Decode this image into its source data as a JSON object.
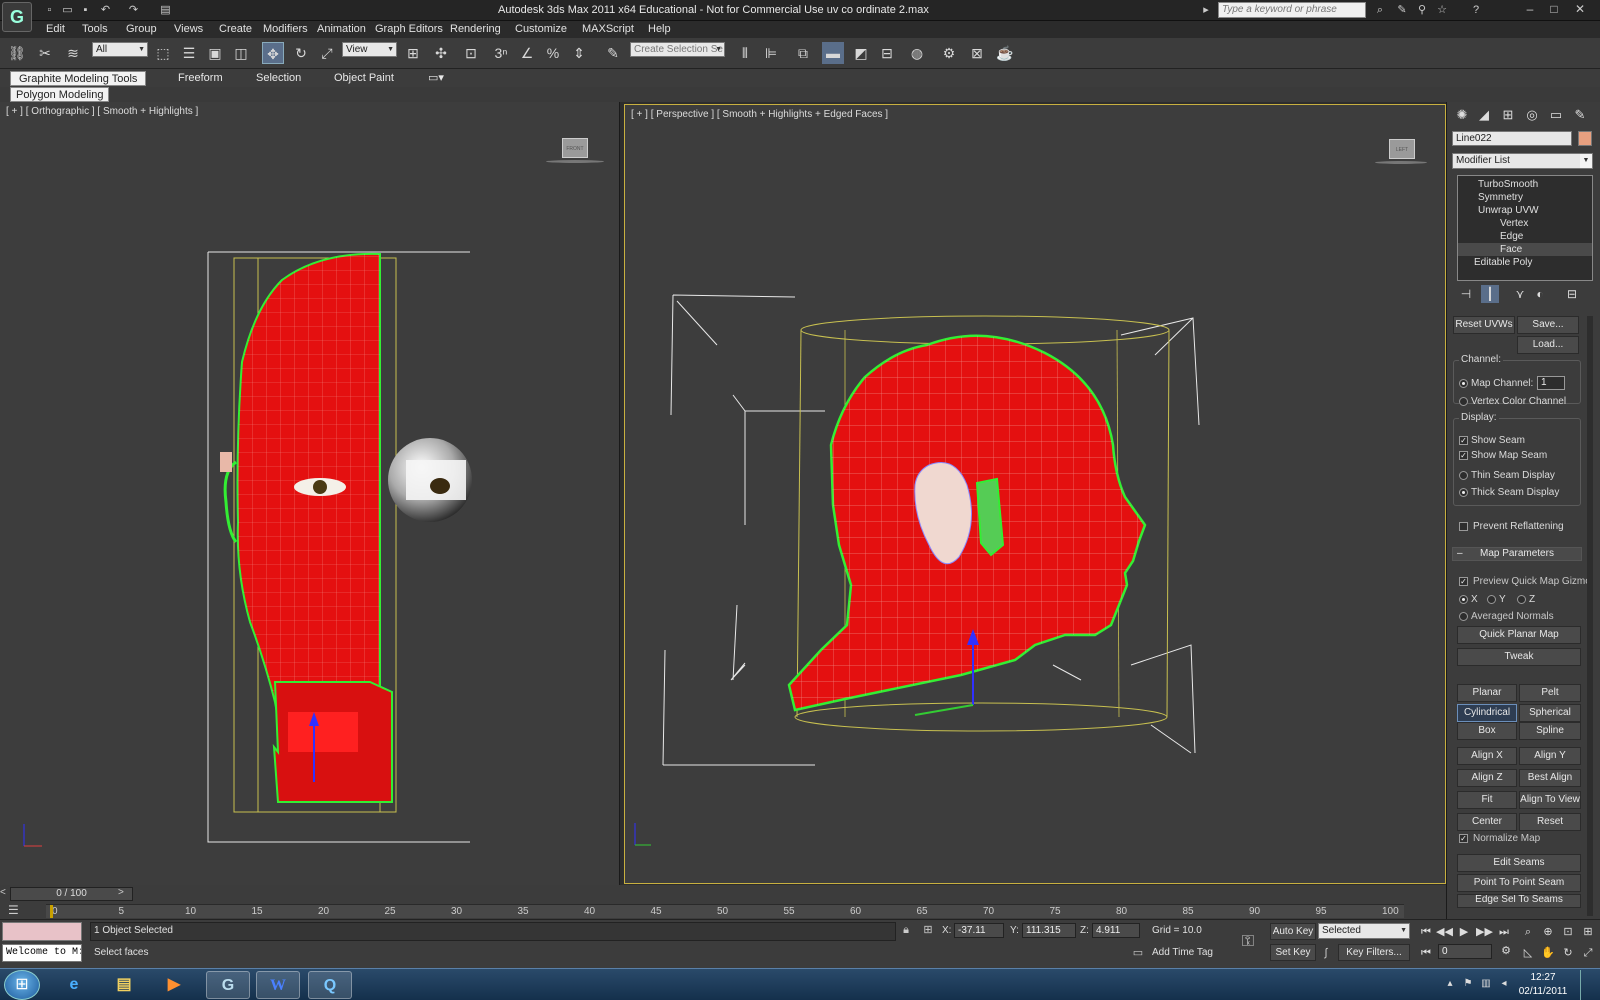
{
  "window": {
    "title": "Autodesk 3ds Max  2011 x64   Educational - Not for Commercial Use    uv co ordinate 2.max",
    "search_placeholder": "Type a keyword or phrase"
  },
  "menu": [
    "Edit",
    "Tools",
    "Group",
    "Views",
    "Create",
    "Modifiers",
    "Animation",
    "Graph Editors",
    "Rendering",
    "Customize",
    "MAXScript",
    "Help"
  ],
  "toolbar": {
    "selection_filter": "All",
    "reference_coord": "View",
    "named_selection_placeholder": "Create Selection Se",
    "snap_angle": "3",
    "snap_percent": "%"
  },
  "ribbon": {
    "tabs": [
      "Graphite Modeling Tools",
      "Freeform",
      "Selection",
      "Object Paint"
    ],
    "active_tab": "Graphite Modeling Tools",
    "panel": "Polygon Modeling"
  },
  "viewports": {
    "left_label": "[ + ] [ Orthographic ] [ Smooth + Highlights ]",
    "right_label": "[ + ] [ Perspective ] [ Smooth + Highlights + Edged Faces ]",
    "left_cube": "FRONT",
    "right_cube": "LEFT"
  },
  "command_panel": {
    "object_name": "Line022",
    "object_color": "#e8a080",
    "modifier_list": "Modifier List",
    "stack": [
      {
        "label": "TurboSmooth",
        "indent": 1,
        "selected": false
      },
      {
        "label": "Symmetry",
        "indent": 1,
        "selected": false
      },
      {
        "label": "Unwrap UVW",
        "indent": 1,
        "selected": false
      },
      {
        "label": "Vertex",
        "indent": 2,
        "selected": false
      },
      {
        "label": "Edge",
        "indent": 2,
        "selected": false
      },
      {
        "label": "Face",
        "indent": 2,
        "selected": true
      },
      {
        "label": "Editable Poly",
        "indent": 0,
        "selected": false
      }
    ],
    "reset_uvws": "Reset UVWs",
    "save": "Save...",
    "load": "Load...",
    "channel_group": "Channel:",
    "map_channel_label": "Map Channel:",
    "map_channel_value": "1",
    "vertex_color_channel": "Vertex Color Channel",
    "display_group": "Display:",
    "show_seam": "Show Seam",
    "show_map_seam": "Show Map Seam",
    "thin_seam": "Thin Seam Display",
    "thick_seam": "Thick Seam Display",
    "prevent_reflattening": "Prevent Reflattening",
    "map_parameters": "Map Parameters",
    "preview_gizmo": "Preview Quick Map Gizmo",
    "axis_x": "X",
    "axis_y": "Y",
    "axis_z": "Z",
    "averaged_normals": "Averaged Normals",
    "quick_planar_map": "Quick Planar Map",
    "tweak": "Tweak",
    "planar": "Planar",
    "pelt": "Pelt",
    "cylindrical": "Cylindrical",
    "spherical": "Spherical",
    "box": "Box",
    "spline": "Spline",
    "align_x": "Align X",
    "align_y": "Align Y",
    "align_z": "Align Z",
    "best_align": "Best Align",
    "fit": "Fit",
    "align_to_view": "Align To View",
    "center": "Center",
    "reset": "Reset",
    "normalize_map": "Normalize Map",
    "edit_seams": "Edit Seams",
    "point_to_point_seam": "Point To Point Seam",
    "edge_sel_to_seams": "Edge Sel To Seams"
  },
  "timeline": {
    "frame": "0 / 100",
    "ticks": [
      "0",
      "5",
      "10",
      "15",
      "20",
      "25",
      "30",
      "35",
      "40",
      "45",
      "50",
      "55",
      "60",
      "65",
      "70",
      "75",
      "80",
      "85",
      "90",
      "95",
      "100"
    ],
    "current_fraction": 0
  },
  "status": {
    "maxscript_line": "Welcome to M:",
    "objects_selected": "1 Object Selected",
    "prompt": "Select faces",
    "x_label": "X:",
    "x_value": "-37.11",
    "y_label": "Y:",
    "y_value": "111.315",
    "z_label": "Z:",
    "z_value": "4.911",
    "grid": "Grid = 10.0",
    "add_time_tag": "Add Time Tag",
    "auto_key": "Auto Key",
    "set_key": "Set Key",
    "key_mode": "Selected",
    "key_filters": "Key Filters...",
    "current_frame": "0"
  },
  "taskbar": {
    "time": "12:27",
    "date": "02/11/2011"
  },
  "colors": {
    "mesh_red": "#e41010",
    "seam_green": "#33ee33",
    "gizmo_yellow": "#c8c050",
    "viewport_bg": "#3d3d3d",
    "active_border": "#c8b040"
  }
}
